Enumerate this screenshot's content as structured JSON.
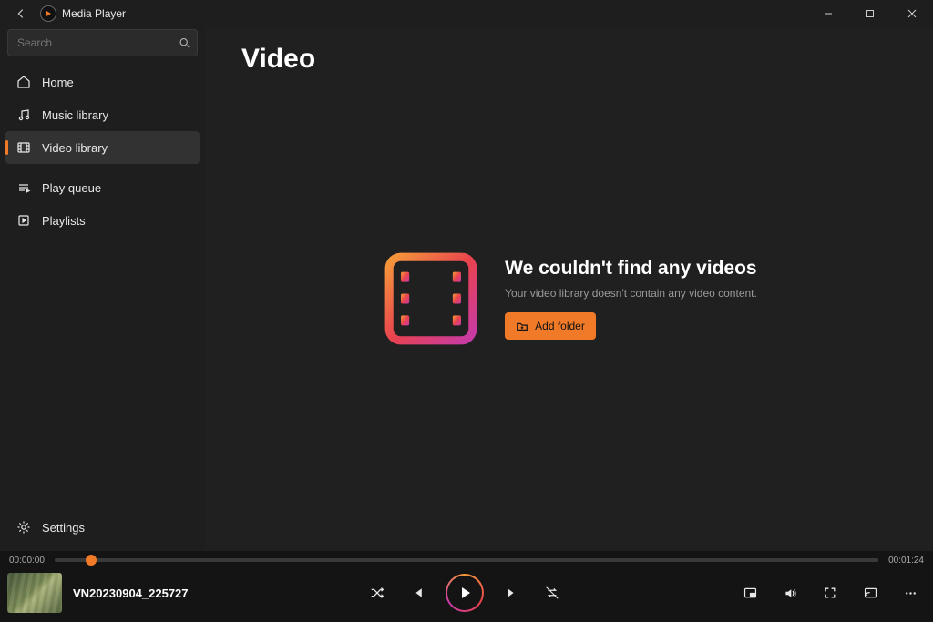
{
  "titlebar": {
    "app_name": "Media Player"
  },
  "search": {
    "placeholder": "Search"
  },
  "sidebar": {
    "items": [
      {
        "label": "Home"
      },
      {
        "label": "Music library"
      },
      {
        "label": "Video library"
      },
      {
        "label": "Play queue"
      },
      {
        "label": "Playlists"
      }
    ],
    "settings_label": "Settings"
  },
  "main": {
    "title": "Video",
    "empty_title": "We couldn't find any videos",
    "empty_sub": "Your video library doesn't contain any video content.",
    "add_folder_label": "Add folder"
  },
  "player": {
    "current_time": "00:00:00",
    "total_time": "00:01:24",
    "now_playing_title": "VN20230904_225727"
  },
  "colors": {
    "accent": "#f07a28"
  }
}
